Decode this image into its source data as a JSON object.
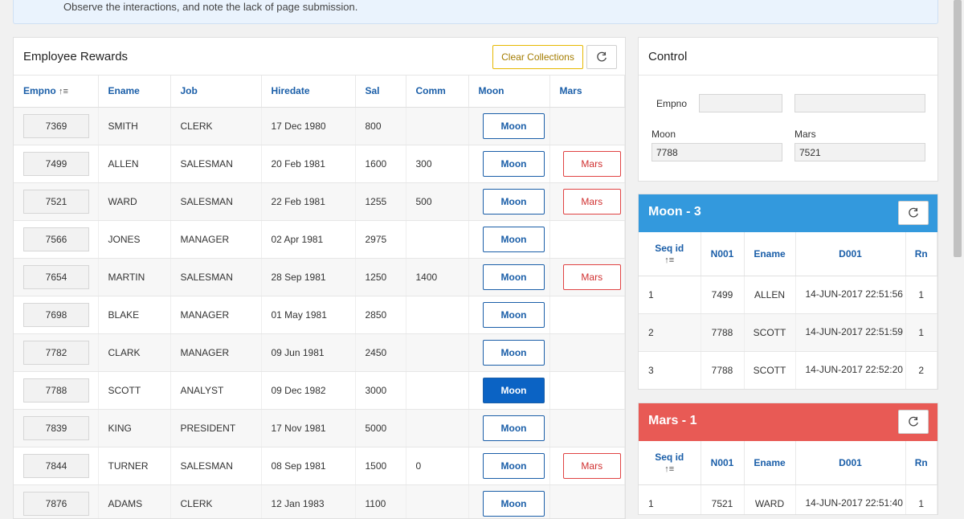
{
  "banner": {
    "text": "Observe the interactions, and note the lack of page submission."
  },
  "rewards": {
    "title": "Employee Rewards",
    "clear_label": "Clear Collections",
    "columns": [
      "Empno",
      "Ename",
      "Job",
      "Hiredate",
      "Sal",
      "Comm",
      "Moon",
      "Mars"
    ],
    "sort_indicator": "↑≡",
    "rows": [
      {
        "empno": "7369",
        "ename": "SMITH",
        "job": "CLERK",
        "hiredate": "17 Dec 1980",
        "sal": "800",
        "comm": "",
        "moon": "Moon",
        "mars": ""
      },
      {
        "empno": "7499",
        "ename": "ALLEN",
        "job": "SALESMAN",
        "hiredate": "20 Feb 1981",
        "sal": "1600",
        "comm": "300",
        "moon": "Moon",
        "mars": "Mars"
      },
      {
        "empno": "7521",
        "ename": "WARD",
        "job": "SALESMAN",
        "hiredate": "22 Feb 1981",
        "sal": "1255",
        "comm": "500",
        "moon": "Moon",
        "mars": "Mars"
      },
      {
        "empno": "7566",
        "ename": "JONES",
        "job": "MANAGER",
        "hiredate": "02 Apr 1981",
        "sal": "2975",
        "comm": "",
        "moon": "Moon",
        "mars": ""
      },
      {
        "empno": "7654",
        "ename": "MARTIN",
        "job": "SALESMAN",
        "hiredate": "28 Sep 1981",
        "sal": "1250",
        "comm": "1400",
        "moon": "Moon",
        "mars": "Mars"
      },
      {
        "empno": "7698",
        "ename": "BLAKE",
        "job": "MANAGER",
        "hiredate": "01 May 1981",
        "sal": "2850",
        "comm": "",
        "moon": "Moon",
        "mars": ""
      },
      {
        "empno": "7782",
        "ename": "CLARK",
        "job": "MANAGER",
        "hiredate": "09 Jun 1981",
        "sal": "2450",
        "comm": "",
        "moon": "Moon",
        "mars": ""
      },
      {
        "empno": "7788",
        "ename": "SCOTT",
        "job": "ANALYST",
        "hiredate": "09 Dec 1982",
        "sal": "3000",
        "comm": "",
        "moon": "Moon",
        "mars": "",
        "moon_active": true
      },
      {
        "empno": "7839",
        "ename": "KING",
        "job": "PRESIDENT",
        "hiredate": "17 Nov 1981",
        "sal": "5000",
        "comm": "",
        "moon": "Moon",
        "mars": ""
      },
      {
        "empno": "7844",
        "ename": "TURNER",
        "job": "SALESMAN",
        "hiredate": "08 Sep 1981",
        "sal": "1500",
        "comm": "0",
        "moon": "Moon",
        "mars": "Mars"
      },
      {
        "empno": "7876",
        "ename": "ADAMS",
        "job": "CLERK",
        "hiredate": "12 Jan 1983",
        "sal": "1100",
        "comm": "",
        "moon": "Moon",
        "mars": ""
      }
    ]
  },
  "control": {
    "title": "Control",
    "empno_label": "Empno",
    "empno_value": "",
    "empno_value2": "",
    "moon_label": "Moon",
    "moon_value": "7788",
    "mars_label": "Mars",
    "mars_value": "7521"
  },
  "moon_collection": {
    "title": "Moon - 3",
    "color": "#3399dd",
    "columns": [
      "Seq id",
      "N001",
      "Ename",
      "D001",
      "Rn"
    ],
    "rows": [
      {
        "seq": "1",
        "n001": "7499",
        "ename": "ALLEN",
        "d001": "14-JUN-2017 22:51:56",
        "rn": "1"
      },
      {
        "seq": "2",
        "n001": "7788",
        "ename": "SCOTT",
        "d001": "14-JUN-2017 22:51:59",
        "rn": "1"
      },
      {
        "seq": "3",
        "n001": "7788",
        "ename": "SCOTT",
        "d001": "14-JUN-2017 22:52:20",
        "rn": "2"
      }
    ]
  },
  "mars_collection": {
    "title": "Mars - 1",
    "color": "#e85a55",
    "columns": [
      "Seq id",
      "N001",
      "Ename",
      "D001",
      "Rn"
    ],
    "rows": [
      {
        "seq": "1",
        "n001": "7521",
        "ename": "WARD",
        "d001": "14-JUN-2017 22:51:40",
        "rn": "1"
      }
    ]
  },
  "colors": {
    "link_blue": "#1a5ea8",
    "moon_active": "#0b63c4",
    "mars_red": "#e04343",
    "clear_gold": "#e6b800"
  }
}
